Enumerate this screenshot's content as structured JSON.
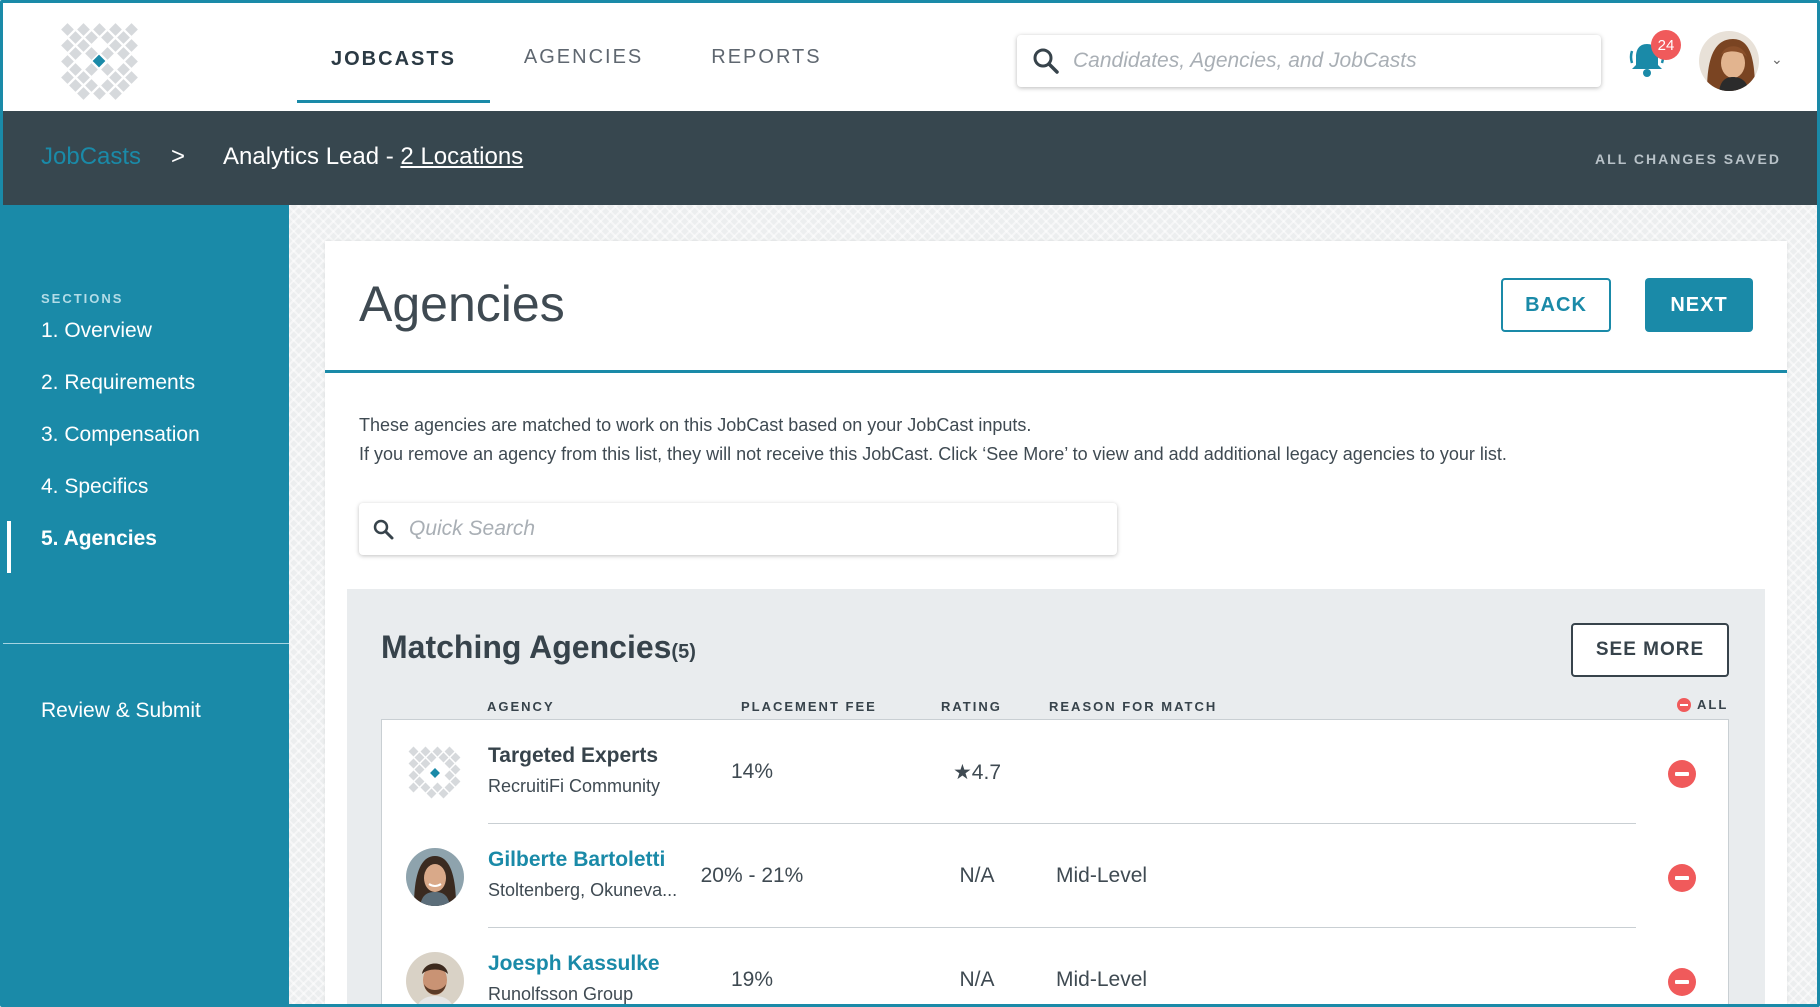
{
  "nav": {
    "tabs": [
      {
        "label": "JOBCASTS"
      },
      {
        "label": "AGENCIES"
      },
      {
        "label": "REPORTS"
      }
    ],
    "search_placeholder": "Candidates, Agencies, and JobCasts",
    "notification_count": "24"
  },
  "breadcrumb": {
    "parent": "JobCasts",
    "separator": ">",
    "title": "Analytics Lead - ",
    "locations": "2 Locations",
    "save_status": "ALL CHANGES SAVED"
  },
  "sidebar": {
    "section_label": "SECTIONS",
    "items": [
      {
        "label": "1. Overview"
      },
      {
        "label": "2. Requirements"
      },
      {
        "label": "3. Compensation"
      },
      {
        "label": "4. Specifics"
      },
      {
        "label": "5. Agencies"
      }
    ],
    "review_label": "Review & Submit"
  },
  "main": {
    "title": "Agencies",
    "back_label": "BACK",
    "next_label": "NEXT",
    "description_line1": "These agencies are matched to work on this JobCast based on your JobCast inputs.",
    "description_line2": "If you remove an agency from this list, they will not receive this JobCast. Click ‘See More’ to view and add additional legacy agencies to your list.",
    "quick_search_placeholder": "Quick Search"
  },
  "matching": {
    "title": "Matching Agencies",
    "count": "(5)",
    "see_more_label": "SEE MORE",
    "columns": {
      "agency": "AGENCY",
      "fee": "PLACEMENT FEE",
      "rating": "RATING",
      "reason": "REASON FOR MATCH",
      "all": "ALL"
    },
    "rows": [
      {
        "name": "Targeted Experts",
        "sub": "RecruitiFi Community",
        "fee": "14%",
        "rating": "★4.7",
        "reason": ""
      },
      {
        "name": "Gilberte Bartoletti",
        "sub": "Stoltenberg, Okuneva...",
        "fee": "20% - 21%",
        "rating": "N/A",
        "reason": "Mid-Level"
      },
      {
        "name": "Joesph Kassulke",
        "sub": "Runolfsson Group",
        "fee": "19%",
        "rating": "N/A",
        "reason": "Mid-Level"
      }
    ]
  },
  "colors": {
    "accent": "#1a8aa8",
    "dark_bar": "#37474f",
    "remove": "#f05a5b"
  }
}
